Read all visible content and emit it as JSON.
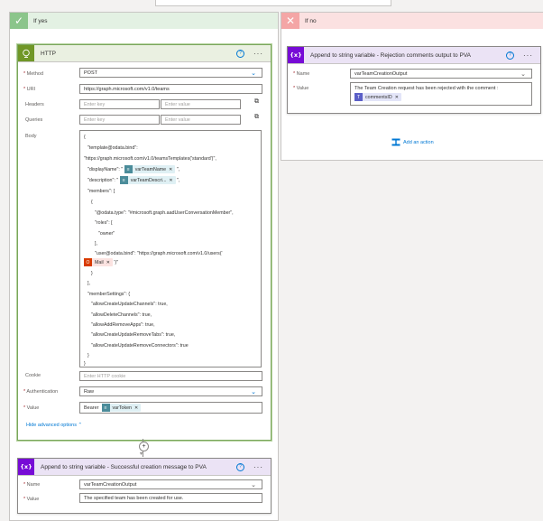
{
  "branches": {
    "yes": {
      "title": "If yes",
      "icon": "checkmark-icon"
    },
    "no": {
      "title": "If no",
      "icon": "close-icon"
    }
  },
  "http": {
    "title": "HTTP",
    "method_label": "Method",
    "method_value": "POST",
    "uri_label": "URI",
    "uri_value": "https://graph.microsoft.com/v1.0/teams",
    "headers_label": "Headers",
    "queries_label": "Queries",
    "key_placeholder": "Enter key",
    "value_placeholder": "Enter value",
    "body_label": "Body",
    "body_lines": [
      "{",
      "\"template@odata.bind\":",
      "\"https://graph.microsoft.com/v1.0/teamsTemplates('standard')\",",
      "\"displayName\": \"",
      "\"description\": \"",
      "\"members\": [",
      "{",
      "\"@odata.type\": \"#microsoft.graph.aadUserConversationMember\",",
      "\"roles\": [",
      "\"owner\"",
      "],",
      "\"user@odata.bind\": \"https://graph.microsoft.com/v1.0/users('",
      "}",
      "],",
      "\"memberSettings\": {",
      "\"allowCreateUpdateChannels\": true,",
      "\"allowDeleteChannels\": true,",
      "\"allowAddRemoveApps\": true,",
      "\"allowCreateUpdateRemoveTabs\": true,",
      "\"allowCreateUpdateRemoveConnectors\": true",
      "}",
      "}"
    ],
    "token_team_name": "varTeamName",
    "token_team_desc": "varTeamDescri...",
    "token_mail": "Mail",
    "after_token_1": "\",",
    "after_token_2": "\",",
    "after_mail": "')\"",
    "cookie_label": "Cookie",
    "cookie_placeholder": "Enter HTTP cookie",
    "auth_label": "Authentication",
    "auth_value": "Raw",
    "value_label": "Value",
    "value_prefix": "Bearer",
    "token_var": "varToken",
    "hide_advanced": "Hide advanced options"
  },
  "append_success": {
    "title": "Append to string variable - Successful creation message to PVA",
    "name_label": "Name",
    "name_value": "varTeamCreationOutput",
    "value_label": "Value",
    "value_text": "The specified team has been created for use."
  },
  "append_reject": {
    "title": "Append to string variable - Rejection comments output to PVA",
    "name_label": "Name",
    "name_value": "varTeamCreationOutput",
    "value_label": "Value",
    "value_text": "The Team Creation request has been rejected with the comment :",
    "token_comments": "commentsID"
  },
  "add_action": "Add an action",
  "colors": {
    "http": "#709727",
    "variable": "#770bd6",
    "accent": "#0078d4"
  }
}
